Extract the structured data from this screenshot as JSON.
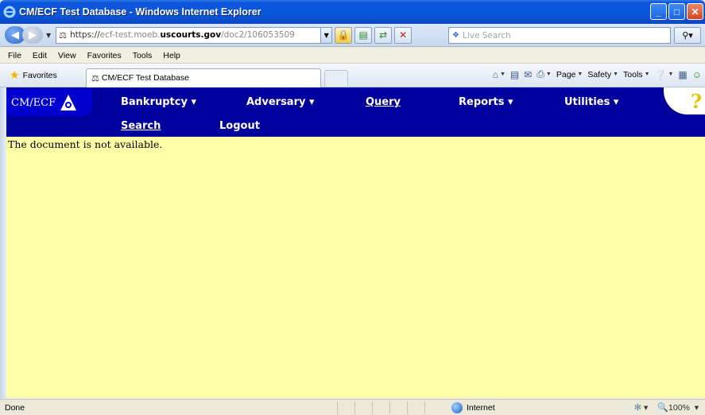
{
  "window": {
    "title": "CM/ECF Test Database - Windows Internet Explorer",
    "buttons": {
      "minimize": "_",
      "maximize": "□",
      "close": "✕"
    }
  },
  "address": {
    "scheme": "https://",
    "host_pre": "ecf-test.moeb.",
    "host": "uscourts.gov",
    "path": "/doc2/106053509",
    "search_placeholder": "Live Search"
  },
  "menu": {
    "items": [
      {
        "label": "File"
      },
      {
        "label": "Edit"
      },
      {
        "label": "View"
      },
      {
        "label": "Favorites"
      },
      {
        "label": "Tools"
      },
      {
        "label": "Help"
      }
    ]
  },
  "favbar": {
    "favorites_label": "Favorites",
    "tab_label": "CM/ECF Test Database",
    "commands": {
      "page": "Page",
      "safety": "Safety",
      "tools": "Tools"
    }
  },
  "ecf": {
    "logo_text": "CM/ECF",
    "help_glyph": "?",
    "nav": {
      "bankruptcy": "Bankruptcy",
      "adversary": "Adversary",
      "query": "Query",
      "reports": "Reports",
      "utilities": "Utilities",
      "search": "Search",
      "logout": "Logout"
    }
  },
  "page": {
    "message": "The document is not available."
  },
  "status": {
    "text": "Done",
    "zone": "Internet",
    "zoom": "100%"
  }
}
